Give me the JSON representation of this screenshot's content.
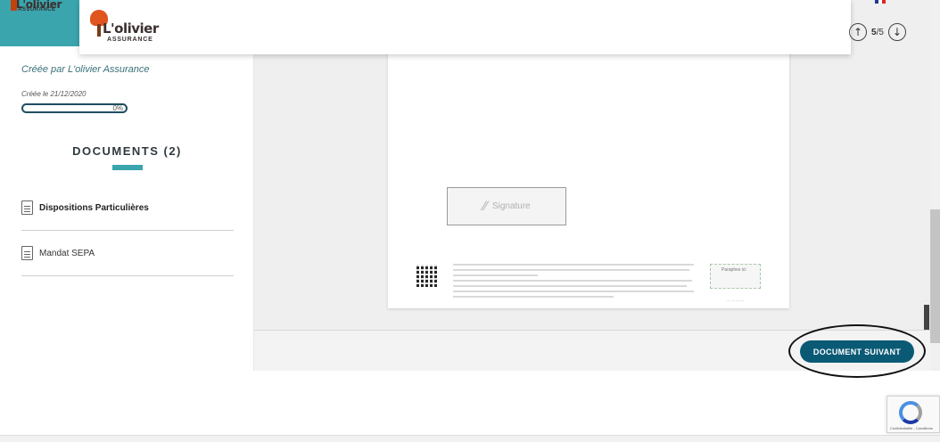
{
  "app": {
    "brand_word": "L'olivier",
    "brand_sub": "ASSURANCE"
  },
  "sidebar": {
    "creator": "Créée par L'olivier Assurance",
    "created_date": "Créée le 21/12/2020",
    "progress_text": "0%",
    "progress_value": 0,
    "documents_title": "DOCUMENTS (2)",
    "documents": [
      {
        "label": "Dispositions Particulières",
        "active": true
      },
      {
        "label": "Mandat SEPA",
        "active": false
      }
    ]
  },
  "viewer": {
    "signature_label": "Signature",
    "signature_icon": "signature-icon",
    "paraphes_label": "Paraphes ici",
    "next_button": "DOCUMENT SUIVANT"
  },
  "nav": {
    "current_page": "5",
    "separator": "/",
    "total_pages": "5",
    "up_icon": "arrow-up-circle-icon",
    "down_icon": "arrow-down-circle-icon"
  },
  "recaptcha": {
    "text": "Confidentialité - Conditions"
  },
  "colors": {
    "accent": "#3aa5ad",
    "button": "#0b5a75",
    "logo_orange": "#e0541e"
  }
}
